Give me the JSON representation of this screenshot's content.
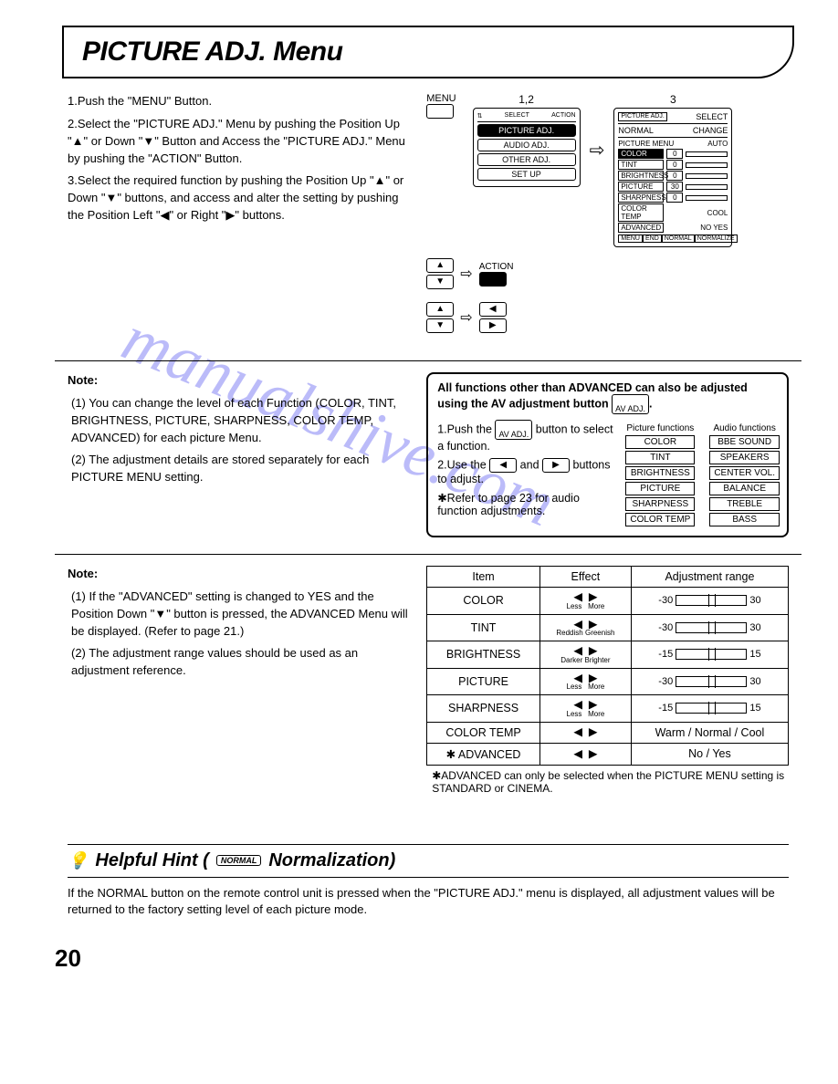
{
  "title": "PICTURE ADJ. Menu",
  "steps": {
    "s1": "1.Push the \"MENU\" Button.",
    "s2": "2.Select the \"PICTURE ADJ.\" Menu by pushing the Position Up \"▲\" or Down \"▼\" Button and Access the \"PICTURE ADJ.\" Menu by pushing the \"ACTION\" Button.",
    "s3": "3.Select the required function by pushing the Position Up \"▲\" or Down \"▼\" buttons, and access and alter the setting by pushing the Position Left \"◀\" or Right \"▶\" buttons."
  },
  "diagram_labels": {
    "menu": "MENU",
    "action": "ACTION",
    "step12": "1,2",
    "step3": "3"
  },
  "osd1": {
    "top_select": "SELECT",
    "top_action": "ACTION",
    "items": [
      "PICTURE ADJ.",
      "AUDIO ADJ.",
      "OTHER ADJ.",
      "SET UP"
    ]
  },
  "osd3": {
    "head_left": "PICTURE ADJ.",
    "head_normal": "NORMAL",
    "head_select": "SELECT",
    "head_change": "CHANGE",
    "menu_label": "PICTURE MENU",
    "menu_value": "AUTO",
    "rows": [
      {
        "lbl": "COLOR",
        "v": "0"
      },
      {
        "lbl": "TINT",
        "v": "0"
      },
      {
        "lbl": "BRIGHTNESS",
        "v": "0"
      },
      {
        "lbl": "PICTURE",
        "v": "30"
      },
      {
        "lbl": "SHARPNESS",
        "v": "0"
      },
      {
        "lbl": "COLOR TEMP",
        "v": "COOL"
      },
      {
        "lbl": "ADVANCED",
        "v": "NO YES"
      }
    ],
    "foot_menu": "MENU",
    "foot_end": "END",
    "foot_normal": "NORMAL",
    "foot_normalize": "NORMALIZE"
  },
  "note1": {
    "head": "Note:",
    "n1": "(1) You can change the level of each Function (COLOR, TINT, BRIGHTNESS, PICTURE, SHARPNESS, COLOR TEMP, ADVANCED) for each picture Menu.",
    "n2": "(2) The adjustment details are stored separately for each PICTURE MENU setting."
  },
  "av_box": {
    "line1": "All functions other than ADVANCED can also be adjusted using the AV adjustment button",
    "av_label": "AV ADJ.",
    "step1": "1.Push the",
    "step1b": "button to select a function.",
    "step2a": "2.Use the",
    "step2b": "and",
    "step2c": "buttons to adjust.",
    "star": "✱Refer to page 23 for audio function adjustments.",
    "pic_head": "Picture functions",
    "aud_head": "Audio functions",
    "pic_fns": [
      "COLOR",
      "TINT",
      "BRIGHTNESS",
      "PICTURE",
      "SHARPNESS",
      "COLOR TEMP"
    ],
    "aud_fns": [
      "BBE SOUND",
      "SPEAKERS",
      "CENTER VOL.",
      "BALANCE",
      "TREBLE",
      "BASS"
    ]
  },
  "note2": {
    "head": "Note:",
    "n1": "(1) If the \"ADVANCED\" setting is changed to YES and the Position Down \"▼\" button is pressed, the ADVANCED Menu will be displayed. (Refer to page 21.)",
    "n2": "(2) The adjustment range values should be used as an adjustment reference."
  },
  "adj_table": {
    "headers": [
      "Item",
      "Effect",
      "Adjustment range"
    ],
    "rows": [
      {
        "item": "COLOR",
        "eff_l": "Less",
        "eff_r": "More",
        "range": "-30 … 30"
      },
      {
        "item": "TINT",
        "eff_l": "Reddish",
        "eff_r": "Greenish",
        "range": "-30 … 30"
      },
      {
        "item": "BRIGHTNESS",
        "eff_l": "Darker",
        "eff_r": "Brighter",
        "range": "-15 … 15"
      },
      {
        "item": "PICTURE",
        "eff_l": "Less",
        "eff_r": "More",
        "range": "-30 … 30"
      },
      {
        "item": "SHARPNESS",
        "eff_l": "Less",
        "eff_r": "More",
        "range": "-15 … 15"
      },
      {
        "item": "COLOR TEMP",
        "eff_l": "",
        "eff_r": "",
        "range": "Warm / Normal / Cool"
      },
      {
        "item": "✱ ADVANCED",
        "eff_l": "",
        "eff_r": "",
        "range": "No / Yes"
      }
    ],
    "footnote": "✱ADVANCED can only be selected when the PICTURE MENU setting is STANDARD or CINEMA."
  },
  "hint": {
    "head_pre": "Helpful Hint (",
    "head_btn": "NORMAL",
    "head_post": " Normalization)",
    "body": "If the NORMAL button on the remote control unit is pressed when the \"PICTURE ADJ.\" menu is displayed, all adjustment values will be returned to the factory setting level of each picture mode."
  },
  "page_number": "20",
  "watermark": "manualshive.com"
}
